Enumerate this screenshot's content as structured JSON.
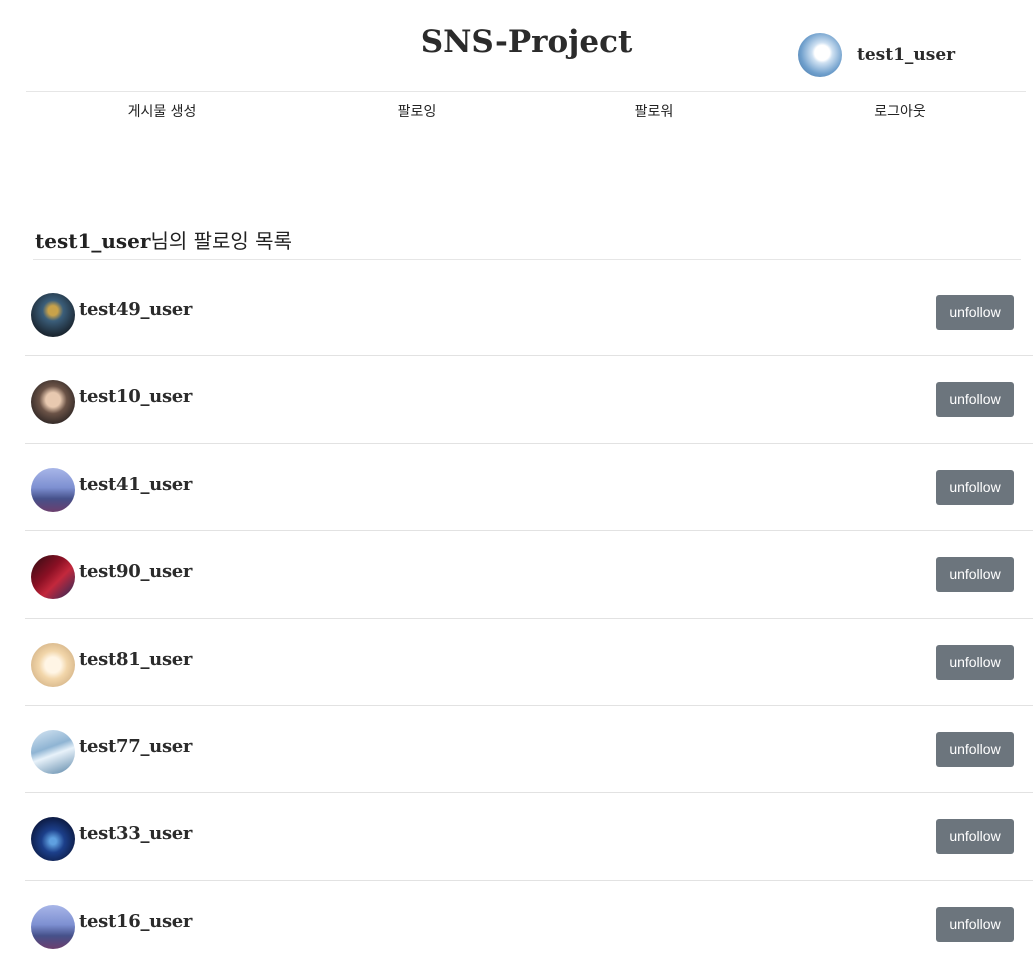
{
  "header": {
    "title": "SNS-Project",
    "current_user": {
      "name": "test1_user",
      "avatar_icon": "profile-photo"
    }
  },
  "nav": {
    "items": [
      {
        "label": "게시물 생성"
      },
      {
        "label": "팔로잉"
      },
      {
        "label": "팔로워"
      },
      {
        "label": "로그아웃"
      }
    ]
  },
  "section": {
    "owner": "test1_user",
    "suffix": "님의 팔로잉 목록"
  },
  "following": [
    {
      "username": "test49_user",
      "button": "unfollow"
    },
    {
      "username": "test10_user",
      "button": "unfollow"
    },
    {
      "username": "test41_user",
      "button": "unfollow"
    },
    {
      "username": "test90_user",
      "button": "unfollow"
    },
    {
      "username": "test81_user",
      "button": "unfollow"
    },
    {
      "username": "test77_user",
      "button": "unfollow"
    },
    {
      "username": "test33_user",
      "button": "unfollow"
    },
    {
      "username": "test16_user",
      "button": "unfollow"
    }
  ],
  "colors": {
    "button_bg": "#6c757d",
    "button_text": "#ffffff",
    "divider": "#e6e6e6",
    "text": "#2b2b2b"
  }
}
